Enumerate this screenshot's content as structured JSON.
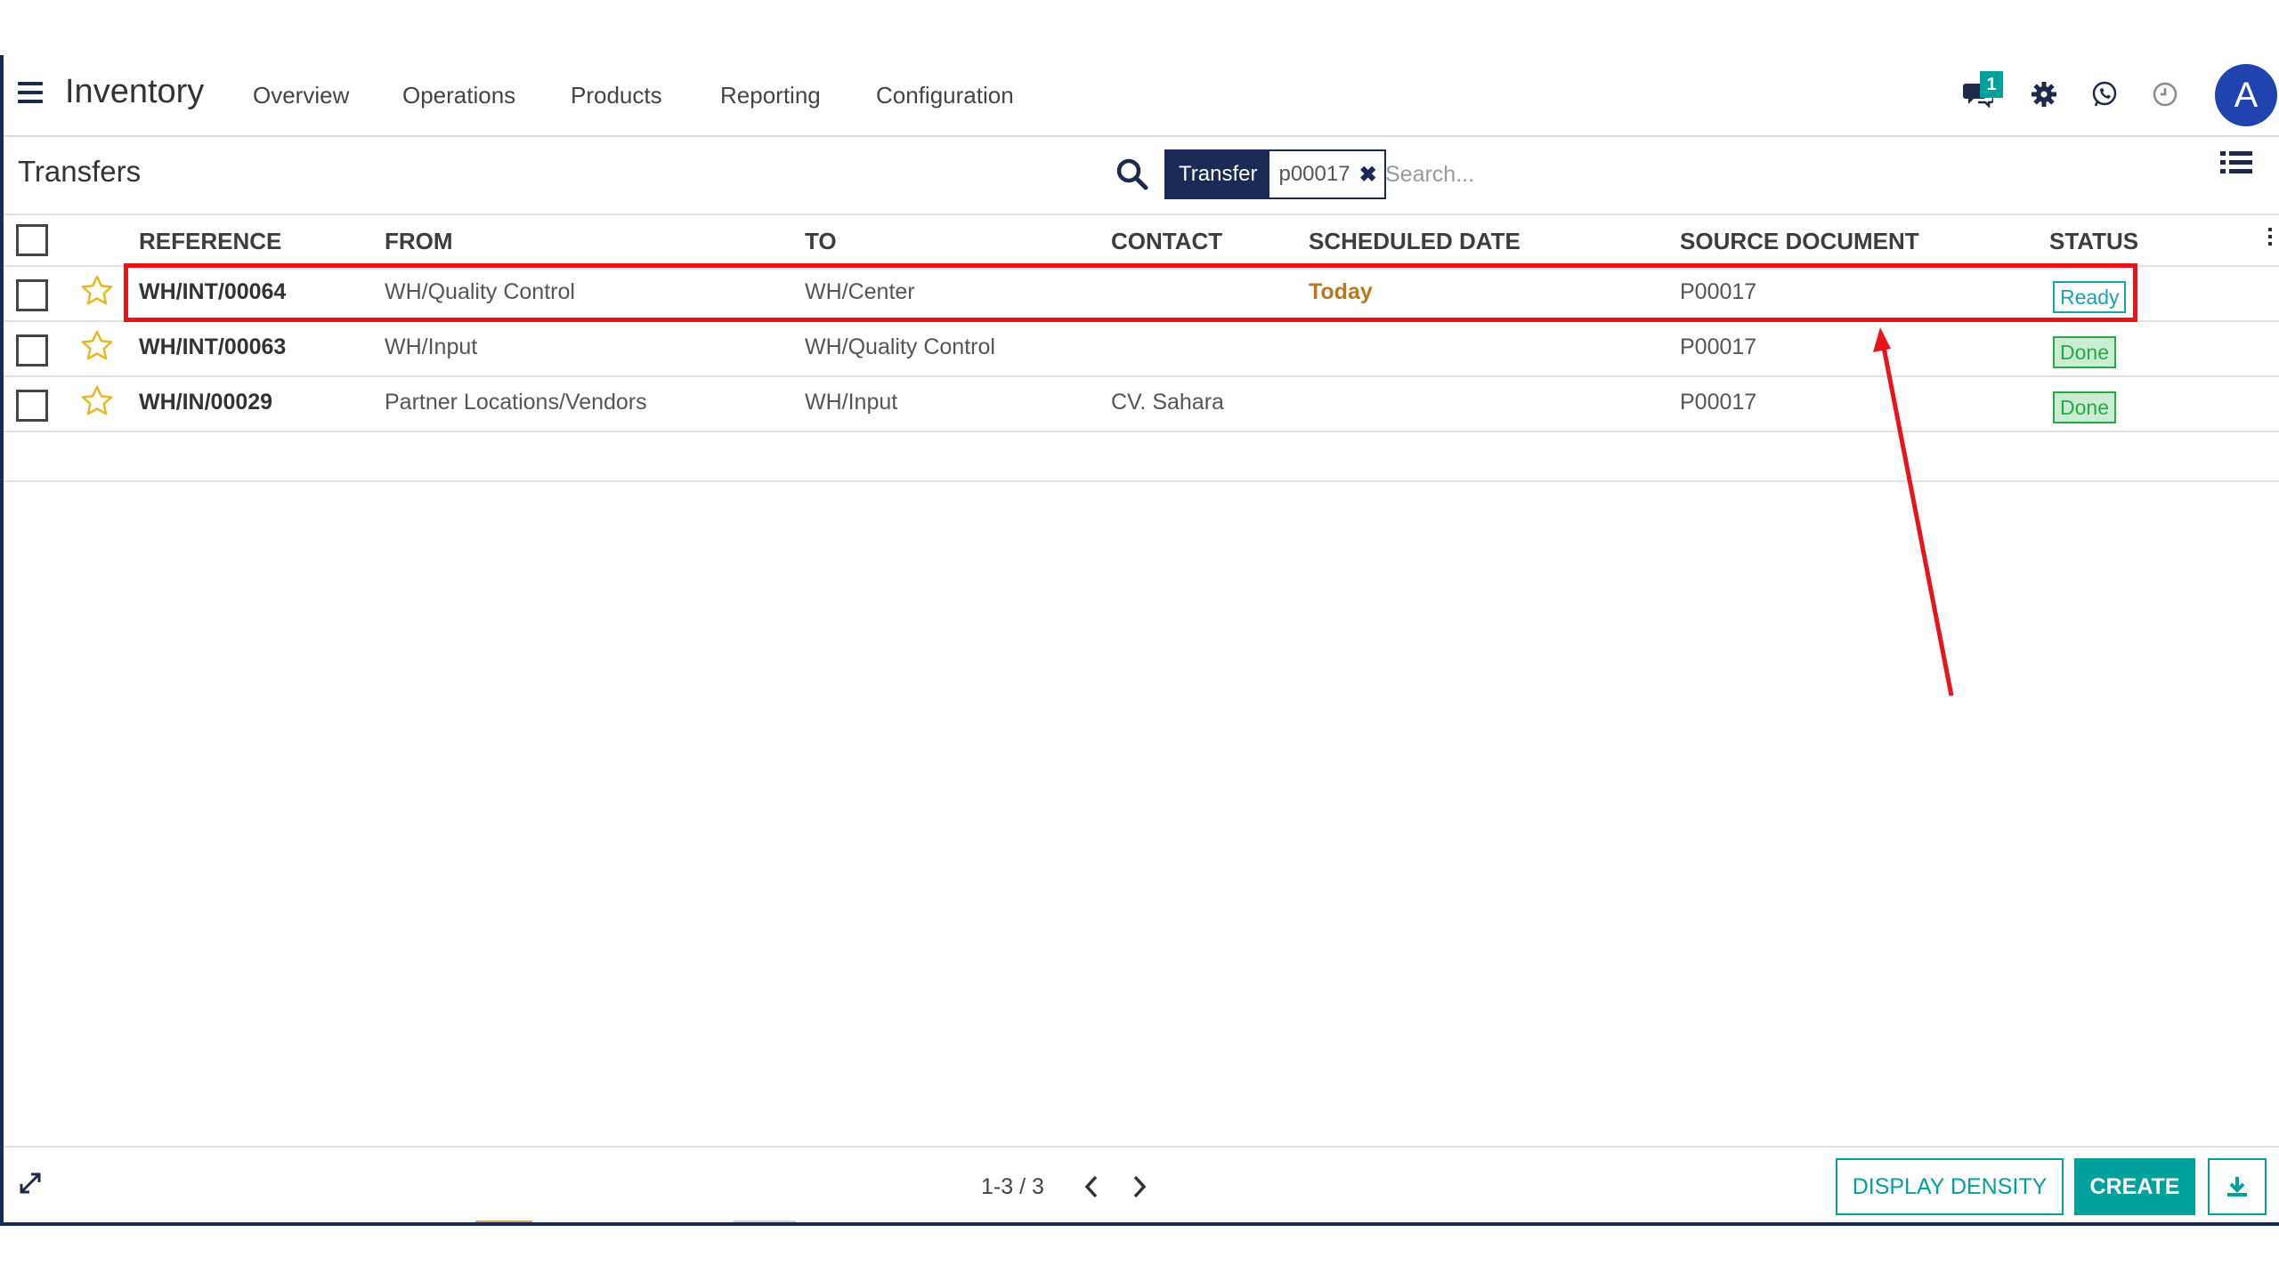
{
  "app": {
    "title": "Inventory"
  },
  "nav": {
    "items": [
      {
        "label": "Overview"
      },
      {
        "label": "Operations"
      },
      {
        "label": "Products"
      },
      {
        "label": "Reporting"
      },
      {
        "label": "Configuration"
      }
    ]
  },
  "systray": {
    "messages_count": "1",
    "icons": [
      "chat-icon",
      "gear-icon",
      "whatsapp-icon",
      "clock-icon"
    ],
    "avatar_initial": "A",
    "avatar_color": "#2143b0"
  },
  "control_panel": {
    "breadcrumb": "Transfers",
    "facet": {
      "label": "Transfer",
      "value": "p00017"
    },
    "search_placeholder": "Search..."
  },
  "table": {
    "columns": [
      "REFERENCE",
      "FROM",
      "TO",
      "CONTACT",
      "SCHEDULED DATE",
      "SOURCE DOCUMENT",
      "STATUS"
    ],
    "rows": [
      {
        "reference": "WH/INT/00064",
        "from": "WH/Quality Control",
        "to": "WH/Center",
        "contact": "",
        "scheduled": "Today",
        "source": "P00017",
        "status": "Ready"
      },
      {
        "reference": "WH/INT/00063",
        "from": "WH/Input",
        "to": "WH/Quality Control",
        "contact": "",
        "scheduled": "",
        "source": "P00017",
        "status": "Done"
      },
      {
        "reference": "WH/IN/00029",
        "from": "Partner Locations/Vendors",
        "to": "WH/Input",
        "contact": "CV. Sahara",
        "scheduled": "",
        "source": "P00017",
        "status": "Done"
      }
    ]
  },
  "footer": {
    "pager": "1-3 / 3",
    "display_density_label": "DISPLAY DENSITY",
    "create_label": "CREATE"
  },
  "colors": {
    "accent": "#00a09d",
    "nav_dark": "#1b2a55",
    "annotation": "#e8141b",
    "today": "#b7781f",
    "ready": "#17a2b8",
    "done": "#28a745"
  }
}
